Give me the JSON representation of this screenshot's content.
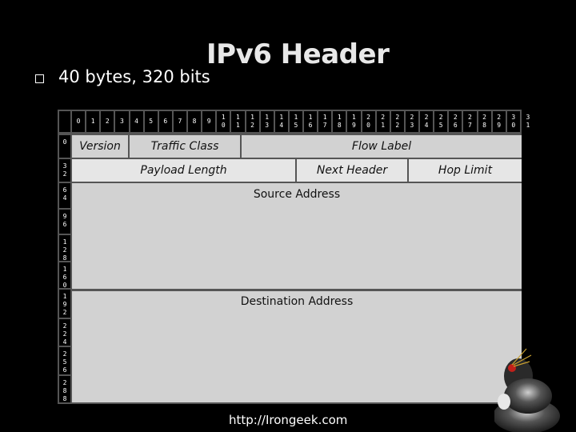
{
  "title": "IPv6 Header",
  "bullet": {
    "icon": "square-bullet-icon",
    "text": "40 bytes, 320 bits"
  },
  "diagram": {
    "bit_columns": [
      "0",
      "1",
      "2",
      "3",
      "4",
      "5",
      "6",
      "7",
      "8",
      "9",
      "10",
      "11",
      "12",
      "13",
      "14",
      "15",
      "16",
      "17",
      "18",
      "19",
      "20",
      "21",
      "22",
      "23",
      "24",
      "25",
      "26",
      "27",
      "28",
      "29",
      "30",
      "31"
    ],
    "row_offsets": [
      "0",
      "32",
      "64",
      "96",
      "128",
      "160",
      "192",
      "224",
      "256",
      "288"
    ],
    "fields": {
      "version": "Version",
      "traffic_class": "Traffic Class",
      "flow_label": "Flow Label",
      "payload_length": "Payload Length",
      "next_header": "Next Header",
      "hop_limit": "Hop Limit",
      "source_address": "Source Address",
      "destination_address": "Destination Address"
    }
  },
  "footer_url": "http://Irongeek.com",
  "mascot": "penguin-mascot-image"
}
